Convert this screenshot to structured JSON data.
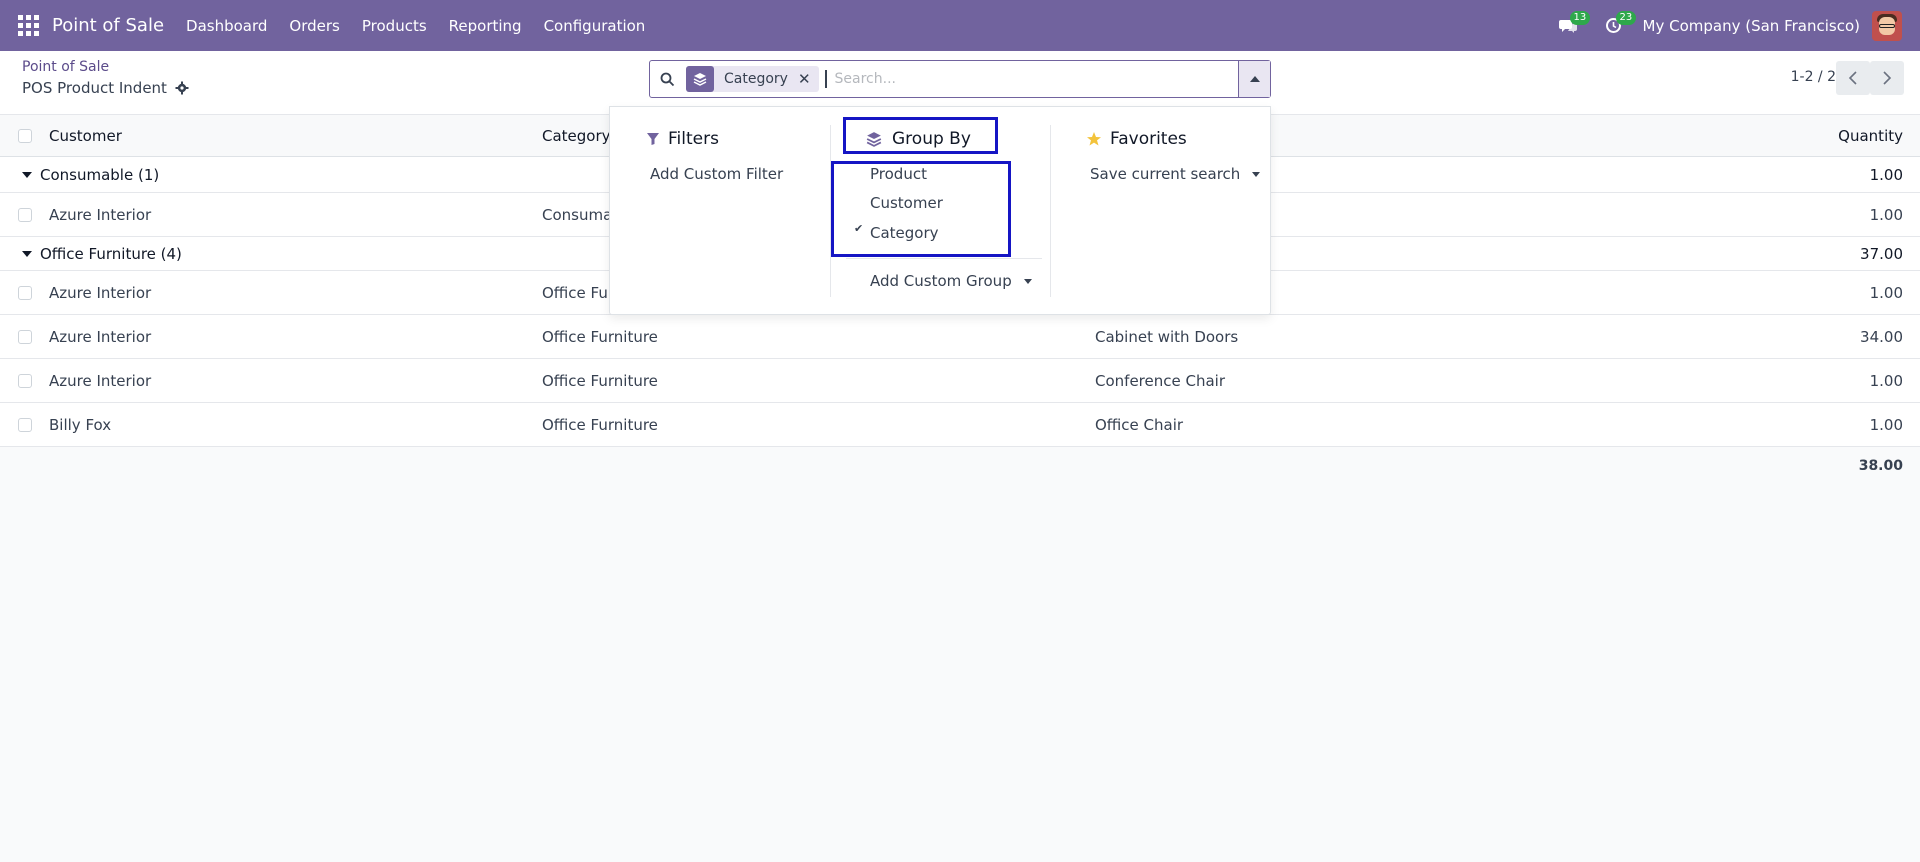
{
  "navbar": {
    "brand": "Point of Sale",
    "menu": [
      "Dashboard",
      "Orders",
      "Products",
      "Reporting",
      "Configuration"
    ],
    "messages_count": "13",
    "activities_count": "23",
    "company": "My Company (San Francisco)"
  },
  "breadcrumb": {
    "parent": "Point of Sale",
    "current": "POS Product Indent"
  },
  "search": {
    "facet_label": "Category",
    "facet_remove": "✕",
    "placeholder": "Search..."
  },
  "pager": {
    "value": "1-2 / 2"
  },
  "list": {
    "columns": {
      "customer": "Customer",
      "category": "Category",
      "quantity": "Quantity"
    },
    "groups": [
      {
        "label": "Consumable (1)",
        "total": "1.00",
        "rows": [
          {
            "customer": "Azure Interior",
            "category": "Consumabl",
            "product": "",
            "quantity": "1.00"
          }
        ]
      },
      {
        "label": "Office Furniture (4)",
        "total": "37.00",
        "rows": [
          {
            "customer": "Azure Interior",
            "category": "Office Furr",
            "product": "",
            "quantity": "1.00"
          },
          {
            "customer": "Azure Interior",
            "category": "Office Furniture",
            "product": "Cabinet with Doors",
            "quantity": "34.00"
          },
          {
            "customer": "Azure Interior",
            "category": "Office Furniture",
            "product": "Conference Chair",
            "quantity": "1.00"
          },
          {
            "customer": "Billy Fox",
            "category": "Office Furniture",
            "product": "Office Chair",
            "quantity": "1.00"
          }
        ]
      }
    ],
    "grand_total": "38.00"
  },
  "dropdown": {
    "filters": {
      "title": "Filters",
      "add_custom": "Add Custom Filter"
    },
    "group_by": {
      "title": "Group By",
      "options": [
        {
          "label": "Product",
          "checked": false
        },
        {
          "label": "Customer",
          "checked": false
        },
        {
          "label": "Category",
          "checked": true
        }
      ],
      "checkmark": "✔",
      "add_custom": "Add Custom Group"
    },
    "favorites": {
      "title": "Favorites",
      "save_search": "Save current search"
    }
  },
  "colors": {
    "brand": "#71639e",
    "highlight": "#1515c4",
    "badge": "#2ea84b",
    "star": "#f3c33b"
  }
}
